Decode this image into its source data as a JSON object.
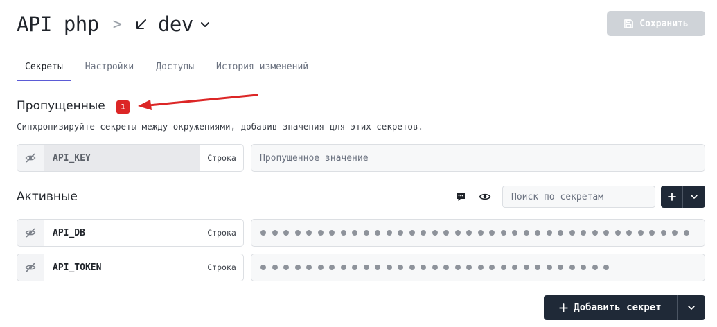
{
  "header": {
    "project": "API php",
    "separator": ">",
    "environment": "dev",
    "save_label": "Сохранить"
  },
  "tabs": [
    {
      "label": "Секреты",
      "active": true
    },
    {
      "label": "Настройки",
      "active": false
    },
    {
      "label": "Доступы",
      "active": false
    },
    {
      "label": "История изменений",
      "active": false
    }
  ],
  "missing": {
    "title": "Пропущенные",
    "count": "1",
    "description": "Синхронизируйте секреты между окружениями, добавив значения для этих секретов.",
    "items": [
      {
        "key": "API_KEY",
        "type": "Строка",
        "value_placeholder": "Пропущенное значение"
      }
    ]
  },
  "active": {
    "title": "Активные",
    "search_placeholder": "Поиск по секретам",
    "items": [
      {
        "key": "API_DB",
        "type": "Строка",
        "masked_length": 38
      },
      {
        "key": "API_TOKEN",
        "type": "Строка",
        "masked_length": 31
      }
    ],
    "add_label": "Добавить секрет"
  },
  "icons": {
    "environment": "arrow-down-left-icon",
    "env_menu": "chevron-down-icon",
    "save": "floppy-disk-icon",
    "visibility_off": "eye-off-icon",
    "comments": "comment-icon",
    "reveal": "eye-icon",
    "add": "plus-icon",
    "more": "chevron-down-icon"
  },
  "colors": {
    "accent": "#5b5bd6",
    "badge": "#dc2626",
    "annotation_arrow": "#dc2626",
    "dark_button": "#1f2937",
    "disabled_button": "#cfd3d8"
  }
}
